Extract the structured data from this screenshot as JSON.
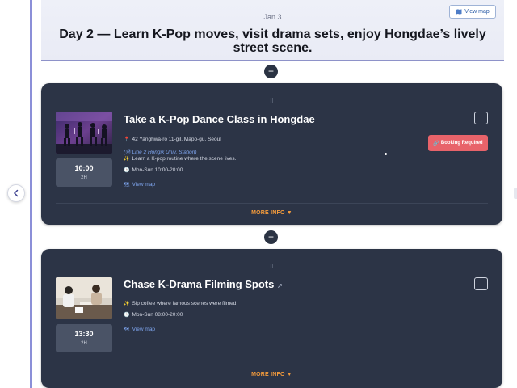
{
  "day": {
    "date": "Jan 3",
    "title": "Day 2 — Learn K-Pop moves, visit drama sets, enjoy Hongdae’s lively street scene.",
    "view_map_label": "View map"
  },
  "add_label": "+",
  "cards": [
    {
      "drag_label": "⠿",
      "title": "Take a K-Pop Dance Class in Hongdae",
      "time": "10:00",
      "duration": "2H",
      "address": "42 Yanghwa-ro 11-gil, Mapo-gu, Seoul",
      "station": "(Ⓜ Line 2 Hongik Univ. Station)",
      "description": "Learn a K-pop routine where the scene lives.",
      "hours": "Mon-Sun 10:00-20:00",
      "view_map_label": "View map",
      "booking_label": "Booking Required",
      "menu_label": "⋮",
      "more_info_label": "MORE INFO ▼"
    },
    {
      "drag_label": "⠿",
      "title": "Chase K-Drama Filming Spots",
      "title_suffix": "↗",
      "time": "13:30",
      "duration": "2H",
      "description": "Sip coffee where famous scenes were filmed.",
      "hours": "Mon-Sun 08:00-20:00",
      "view_map_label": "View map",
      "menu_label": "⋮",
      "more_info_label": "MORE INFO ▼"
    }
  ],
  "icons": {
    "pin": "📍",
    "sparkle": "✨",
    "clock": "🕒",
    "map": "🗺",
    "link": "🔗",
    "chevron_left": "‹"
  },
  "colors": {
    "card_bg": "#2c3446",
    "accent_orange": "#f39b3c",
    "booking_red": "#e8636a",
    "link_blue": "#7fa6f0"
  }
}
